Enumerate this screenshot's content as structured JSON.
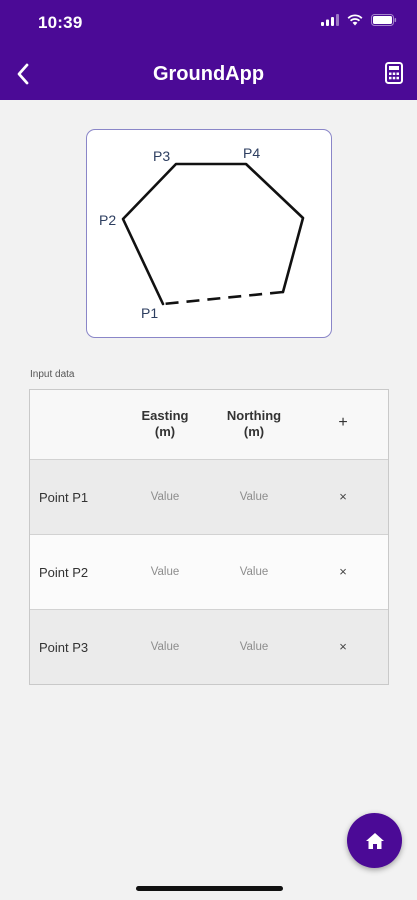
{
  "status": {
    "time": "10:39"
  },
  "header": {
    "title": "GroundApp",
    "back_icon": "chevron-left-icon",
    "calc_icon": "calculator-icon"
  },
  "diagram": {
    "labels": {
      "p1": "P1",
      "p2": "P2",
      "p3": "P3",
      "p4": "P4"
    }
  },
  "input": {
    "section_label": "Input data",
    "columns": {
      "easting_line1": "Easting",
      "easting_line2": "(m)",
      "northing_line1": "Northing",
      "northing_line2": "(m)",
      "add": "+"
    },
    "rows": [
      {
        "label": "Point P1",
        "easting": "",
        "northing": "",
        "delete": "×"
      },
      {
        "label": "Point P2",
        "easting": "",
        "northing": "",
        "delete": "×"
      },
      {
        "label": "Point P3",
        "easting": "",
        "northing": "",
        "delete": "×"
      }
    ],
    "placeholder": "Value"
  },
  "colors": {
    "primary": "#4b0a96",
    "background": "#f2f2f2",
    "card_border": "#8a86c8"
  }
}
